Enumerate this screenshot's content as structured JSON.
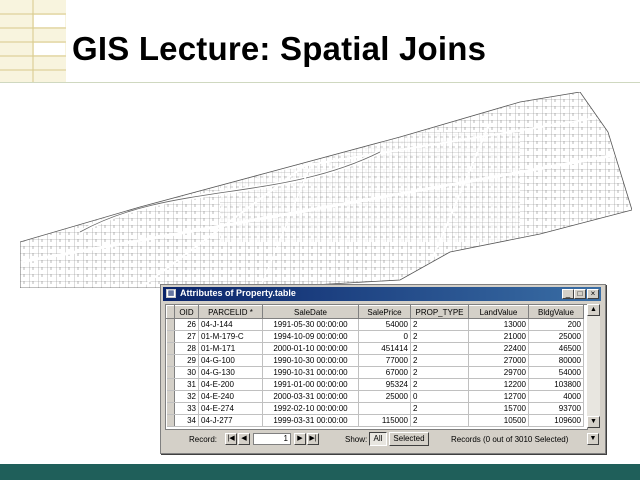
{
  "slide": {
    "title": "GIS Lecture: Spatial Joins",
    "accent_color": "#1f5f5a",
    "deco_color": "#e9d99a"
  },
  "window": {
    "title": "Attributes of Property.table",
    "minimize": "_",
    "maximize": "□",
    "close": "×",
    "columns": [
      "OID",
      "PARCELID *",
      "SaleDate",
      "SalePrice",
      "PROP_TYPE",
      "LandValue",
      "BldgValue"
    ],
    "rows": [
      [
        "26",
        "04-J-144",
        "1991-05-30 00:00:00",
        "54000",
        "2",
        "13000",
        "200"
      ],
      [
        "27",
        "01-M-179-C",
        "1994-10-09 00:00:00",
        "0",
        "2",
        "21000",
        "25000"
      ],
      [
        "28",
        "01-M-171",
        "2000-01-10 00:00:00",
        "451414",
        "2",
        "22400",
        "46500"
      ],
      [
        "29",
        "04-G-100",
        "1990-10-30 00:00:00",
        "77000",
        "2",
        "27000",
        "80000"
      ],
      [
        "30",
        "04-G-130",
        "1990-10-31 00:00:00",
        "67000",
        "2",
        "29700",
        "54000"
      ],
      [
        "31",
        "04-E-200",
        "1991-01-00 00:00:00",
        "95324",
        "2",
        "12200",
        "103800"
      ],
      [
        "32",
        "04-E-240",
        "2000-03-31 00:00:00",
        "25000",
        "0",
        "12700",
        "4000"
      ],
      [
        "33",
        "04-E-274",
        "1992-02-10 00:00:00",
        "",
        "2",
        "15700",
        "93700"
      ],
      [
        "34",
        "04-J-277",
        "1999-03-31 00:00:00",
        "115000",
        "2",
        "10500",
        "109600"
      ]
    ],
    "status": {
      "record_label": "Record:",
      "record_value": "1",
      "show_label": "Show:",
      "all_label": "All",
      "selected_label": "Selected",
      "records_text": "Records (0 out of 3010 Selected)"
    }
  }
}
